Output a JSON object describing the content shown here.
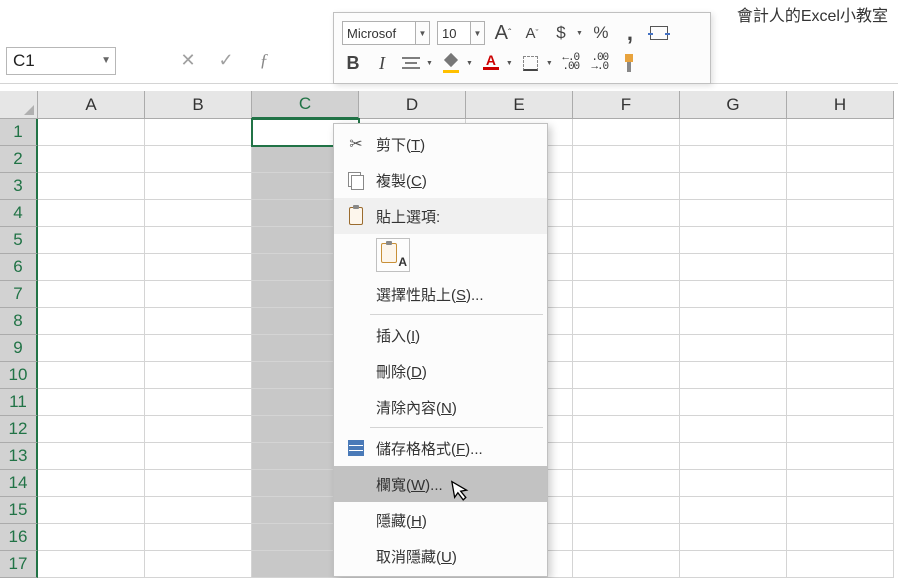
{
  "watermark": "會計人的Excel小教室",
  "nameBox": {
    "value": "C1"
  },
  "miniToolbar": {
    "fontName": "Microsof",
    "fontSize": "10",
    "increaseFont": "A",
    "decreaseFont": "A",
    "currency": "$",
    "percent": "%",
    "comma": ",",
    "bold": "B",
    "italic": "I",
    "fontColorLetter": "A",
    "incDecimal": ".0\n.00",
    "decDecimal": ".00\n.0"
  },
  "columns": [
    "A",
    "B",
    "C",
    "D",
    "E",
    "F",
    "G",
    "H"
  ],
  "rows": [
    "1",
    "2",
    "3",
    "4",
    "5",
    "6",
    "7",
    "8",
    "9",
    "10",
    "11",
    "12",
    "13",
    "14",
    "15",
    "16",
    "17"
  ],
  "selectedCol": "C",
  "activeCell": "C1",
  "contextMenu": {
    "cut": {
      "label": "剪下(",
      "key": "T",
      "suffix": ")"
    },
    "copy": {
      "label": "複製(",
      "key": "C",
      "suffix": ")"
    },
    "pasteOptions": {
      "label": "貼上選項:"
    },
    "pasteSpecial": {
      "label": "選擇性貼上(",
      "key": "S",
      "suffix": ")..."
    },
    "insert": {
      "label": "插入(",
      "key": "I",
      "suffix": ")"
    },
    "delete": {
      "label": "刪除(",
      "key": "D",
      "suffix": ")"
    },
    "clear": {
      "label": "清除內容(",
      "key": "N",
      "suffix": ")"
    },
    "format": {
      "label": "儲存格格式(",
      "key": "F",
      "suffix": ")..."
    },
    "colWidth": {
      "label": "欄寬(",
      "key": "W",
      "suffix": ")..."
    },
    "hide": {
      "label": "隱藏(",
      "key": "H",
      "suffix": ")"
    },
    "unhide": {
      "label": "取消隱藏(",
      "key": "U",
      "suffix": ")"
    }
  }
}
